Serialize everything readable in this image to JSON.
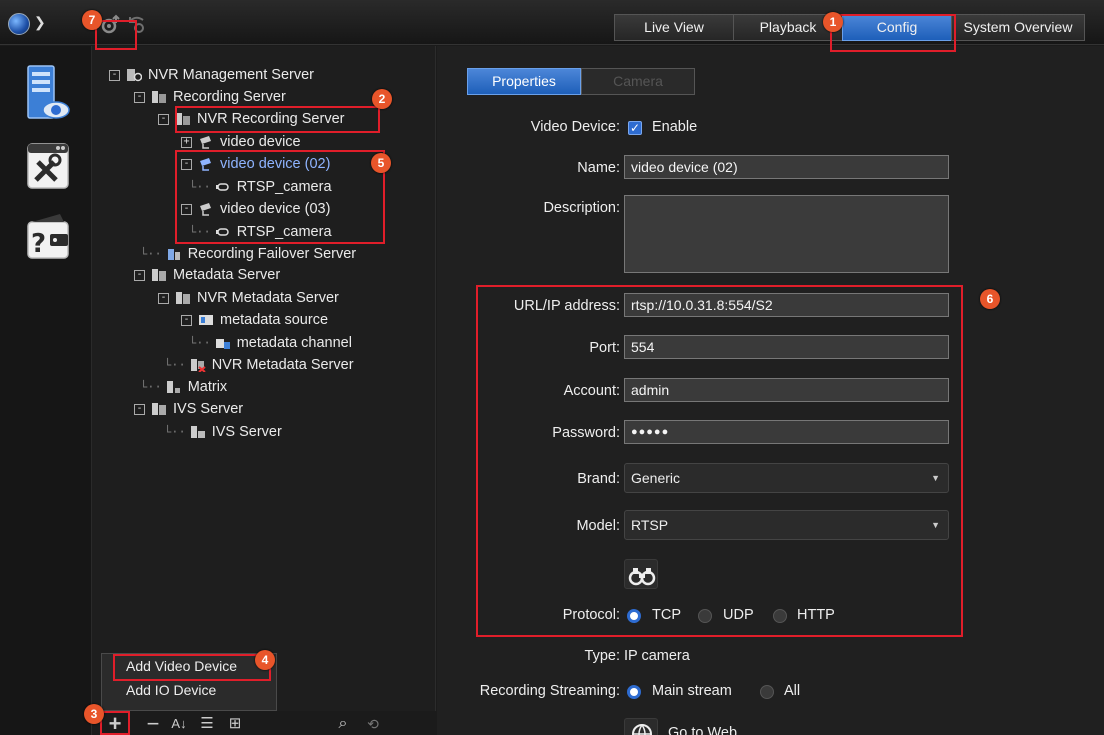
{
  "topbar": {
    "tabs": [
      {
        "label": "Live View",
        "active": false
      },
      {
        "label": "Playback",
        "active": false
      },
      {
        "label": "Config",
        "active": true
      },
      {
        "label": "System Overview",
        "active": false
      }
    ]
  },
  "tree": {
    "nodes": [
      {
        "label": "NVR Management Server"
      },
      {
        "label": "Recording Server"
      },
      {
        "label": "NVR Recording Server"
      },
      {
        "label": "video device"
      },
      {
        "label": "video device (02)"
      },
      {
        "label": "RTSP_camera"
      },
      {
        "label": "video device (03)"
      },
      {
        "label": "RTSP_camera"
      },
      {
        "label": "Recording Failover Server"
      },
      {
        "label": "Metadata Server"
      },
      {
        "label": "NVR Metadata Server"
      },
      {
        "label": "metadata source"
      },
      {
        "label": "metadata channel"
      },
      {
        "label": "NVR Metadata Server"
      },
      {
        "label": "Matrix"
      },
      {
        "label": "IVS Server"
      },
      {
        "label": "IVS Server"
      }
    ]
  },
  "context_menu": {
    "items": [
      "Add Video Device",
      "Add IO Device"
    ]
  },
  "properties": {
    "tabs": [
      "Properties",
      "Camera"
    ],
    "video_device_label": "Video Device:",
    "enable_label": "Enable",
    "name_label": "Name:",
    "name_value": "video device (02)",
    "description_label": "Description:",
    "url_label": "URL/IP address:",
    "url_value": "rtsp://10.0.31.8:554/S2",
    "port_label": "Port:",
    "port_value": "554",
    "account_label": "Account:",
    "account_value": "admin",
    "password_label": "Password:",
    "password_value": "●●●●●",
    "brand_label": "Brand:",
    "brand_value": "Generic",
    "model_label": "Model:",
    "model_value": "RTSP",
    "protocol_label": "Protocol:",
    "protocol_options": [
      "TCP",
      "UDP",
      "HTTP"
    ],
    "protocol_selected": "TCP",
    "type_label": "Type:",
    "type_value": "IP camera",
    "rec_stream_label": "Recording Streaming:",
    "rec_stream_options": [
      "Main stream",
      "All"
    ],
    "goto_web_label": "Go to Web"
  },
  "badges": [
    "1",
    "2",
    "3",
    "4",
    "5",
    "6",
    "7"
  ],
  "colors": {
    "accent": "#2e6cd1",
    "annotation": "#e01e2a",
    "badge": "#e8552a"
  }
}
